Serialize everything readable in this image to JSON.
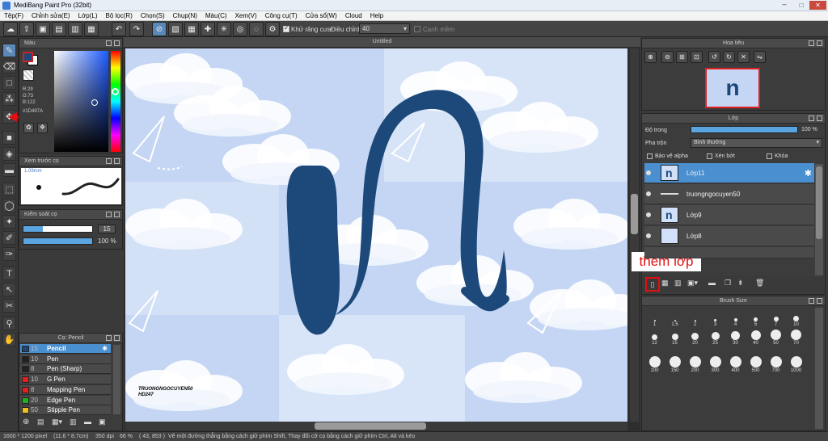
{
  "window": {
    "title": "MediBang Paint Pro (32bit)"
  },
  "menu": [
    "Tệp(F)",
    "Chỉnh sửa(E)",
    "Lớp(L)",
    "Bộ lọc(R)",
    "Chọn(S)",
    "Chụp(N)",
    "Màu(C)",
    "Xem(V)",
    "Công cụ(T)",
    "Cửa sổ(W)",
    "Cloud",
    "Help"
  ],
  "toolbar": {
    "antialias_label": "Khử răng cưa",
    "correction_label": "Điều chỉnh",
    "correction_value": "40",
    "snap_label": "Cạnh mềm"
  },
  "canvas": {
    "tab_title": "Untitled",
    "watermark_line1": "TRUONGNGOCUYEN50",
    "watermark_line2": "HD247"
  },
  "color_panel": {
    "title": "Màu",
    "r": "R:29",
    "g": "G:73",
    "b": "B:122",
    "hex": "#1D497A",
    "main_color": "#1d497a"
  },
  "brush_preview": {
    "title": "Xem trước cọ",
    "size": "1.09mm"
  },
  "brush_control": {
    "title": "Kiểm soát cọ",
    "size_value": "15",
    "opacity_value": "100 %"
  },
  "brush_list": {
    "title": "Cọ: Pencil",
    "items": [
      {
        "size": "15",
        "name": "Pencil",
        "color": "#1d497a",
        "selected": true
      },
      {
        "size": "10",
        "name": "Pen",
        "color": "#222222"
      },
      {
        "size": "8",
        "name": "Pen (Sharp)",
        "color": "#222222"
      },
      {
        "size": "10",
        "name": "G Pen",
        "color": "#e02020"
      },
      {
        "size": "8",
        "name": "Mapping Pen",
        "color": "#e02020"
      },
      {
        "size": "20",
        "name": "Edge Pen",
        "color": "#20b020"
      },
      {
        "size": "50",
        "name": "Stipple Pen",
        "color": "#f0c020"
      }
    ]
  },
  "navigator": {
    "title": "Hoa tiêu"
  },
  "layer_panel": {
    "title": "Lớp",
    "opacity_label": "Độ trong",
    "opacity_value": "100 %",
    "blend_label": "Pha trộn",
    "blend_value": "Bình thường",
    "protect_alpha": "Bảo vệ alpha",
    "clipping": "Xén bớt",
    "lock": "Khóa",
    "layers": [
      {
        "name": "Lớp11",
        "selected": true
      },
      {
        "name": "truongngocuyen50"
      },
      {
        "name": "Lớp9"
      },
      {
        "name": "Lớp8"
      }
    ],
    "annotation": "thêm lớp"
  },
  "brush_size": {
    "title": "Brush Size",
    "rows": [
      [
        "1",
        "1.5",
        "2",
        "3",
        "4",
        "5",
        "7",
        "10"
      ],
      [
        "12",
        "15",
        "20",
        "25",
        "30",
        "40",
        "50",
        "70"
      ],
      [
        "100",
        "150",
        "200",
        "300",
        "400",
        "500",
        "700",
        "1000"
      ]
    ]
  },
  "status": {
    "pixels": "1600 * 1200 pixel",
    "size_cm": "(11.6 * 8.7cm)",
    "dpi": "350 dpi",
    "zoom": "66 %",
    "coords": "( 43, 853 )",
    "hint": "Vẽ một đường thẳng bằng cách giữ phím Shift, Thay đổi cỡ cọ bằng cách giữ phím Ctrl, Alt và kéo"
  }
}
